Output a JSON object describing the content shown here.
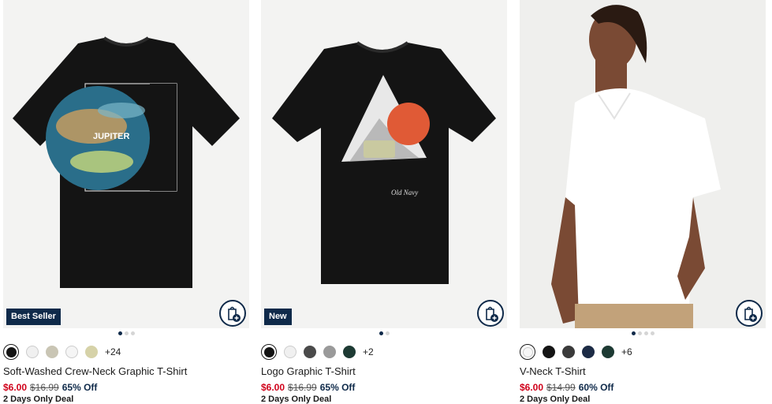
{
  "products": [
    {
      "badge": "Best Seller",
      "name": "Soft-Washed Crew-Neck Graphic T-Shirt",
      "sale_price": "$6.00",
      "original_price": "$16.99",
      "discount": "65% Off",
      "deal": "2 Days Only Deal",
      "more_colors": "+24",
      "graphic_text": "JUPITER"
    },
    {
      "badge": "New",
      "name": "Logo Graphic T-Shirt",
      "sale_price": "$6.00",
      "original_price": "$16.99",
      "discount": "65% Off",
      "deal": "2 Days Only Deal",
      "more_colors": "+2",
      "graphic_text": "Old Navy"
    },
    {
      "name": "V-Neck T-Shirt",
      "sale_price": "$6.00",
      "original_price": "$14.99",
      "discount": "60% Off",
      "deal": "2 Days Only Deal",
      "more_colors": "+6"
    }
  ],
  "colors": {
    "navy": "#0f2a4a",
    "sale_red": "#d0021b",
    "image_bg": "#f3f3f2"
  },
  "icons": {
    "add_to_bag": "bag-plus-icon"
  }
}
